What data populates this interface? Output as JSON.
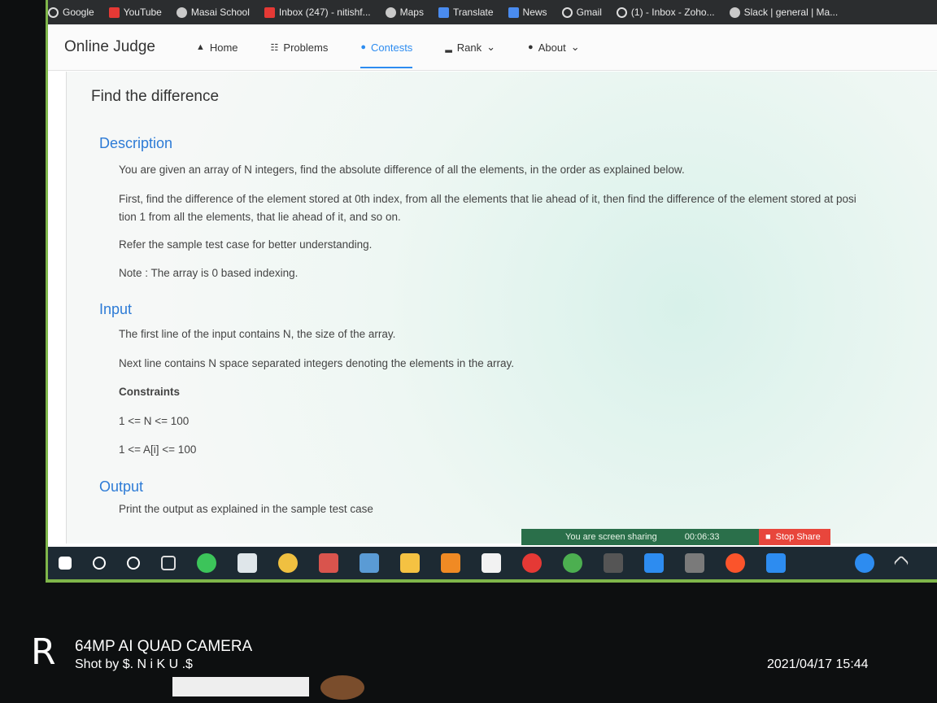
{
  "bookmarks": [
    "Google",
    "YouTube",
    "Masai School",
    "Inbox (247) - nitishf...",
    "Maps",
    "Translate",
    "News",
    "Gmail",
    "(1) - Inbox - Zoho...",
    "Slack | general | Ma..."
  ],
  "navbar": {
    "brand": "Online Judge",
    "home": "Home",
    "problems": "Problems",
    "contests": "Contests",
    "rank": "Rank",
    "about": "About"
  },
  "problem": {
    "title": "Find the difference",
    "description_heading": "Description",
    "desc1": "You are given an array of N integers, find the absolute difference of all the elements, in the order as explained below.",
    "desc2a": "First, find the difference of the element stored at 0th index, from all the elements that lie ahead of it, then find the difference of the element stored at posi",
    "desc2b": "tion 1 from all the elements, that lie ahead of it, and so on.",
    "desc3": "Refer the sample test case for better understanding.",
    "desc4": "Note : The array is 0 based indexing.",
    "input_heading": "Input",
    "input1": "The first line of the input contains N, the size of the array.",
    "input2": "Next line contains N space separated integers denoting the elements in the array.",
    "constraints_heading": "Constraints",
    "c1": "1 <= N <= 100",
    "c2": "1 <= A[i] <= 100",
    "output_heading": "Output",
    "output1": "Print the output as explained in the sample test case"
  },
  "sharebar": {
    "text": "You are screen sharing",
    "time": "00:06:33",
    "stop": "Stop Share"
  },
  "overlay": {
    "camera": "64MP AI QUAD CAMERA",
    "shot": "Shot by $. N i K U .$",
    "stamp": "2021/04/17 15:44"
  }
}
